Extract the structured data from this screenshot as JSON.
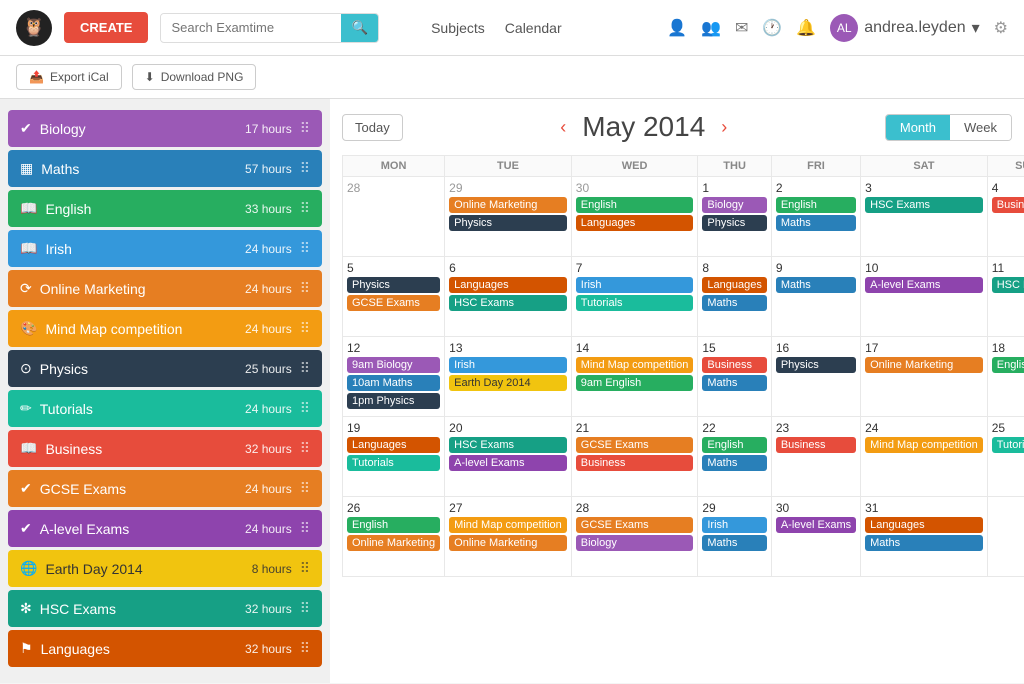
{
  "header": {
    "create_label": "CREATE",
    "search_placeholder": "Search Examtime",
    "nav": [
      "Subjects",
      "Calendar"
    ],
    "username": "andrea.leyden",
    "icons": [
      "person",
      "group",
      "mail",
      "history",
      "bell"
    ]
  },
  "toolbar": {
    "export_label": "Export iCal",
    "download_label": "Download PNG"
  },
  "sidebar": {
    "items": [
      {
        "id": "biology",
        "label": "Biology",
        "hours": "17 hours",
        "color": "#9b59b6",
        "icon": "✔",
        "css": "c-biology"
      },
      {
        "id": "maths",
        "label": "Maths",
        "hours": "57 hours",
        "color": "#2980b9",
        "icon": "▦",
        "css": "c-maths"
      },
      {
        "id": "english",
        "label": "English",
        "hours": "33 hours",
        "color": "#27ae60",
        "icon": "📖",
        "css": "c-english"
      },
      {
        "id": "irish",
        "label": "Irish",
        "hours": "24 hours",
        "color": "#3498db",
        "icon": "📖",
        "css": "c-irish"
      },
      {
        "id": "online-marketing",
        "label": "Online Marketing",
        "hours": "24 hours",
        "color": "#e67e22",
        "icon": "⟳",
        "css": "c-online-marketing"
      },
      {
        "id": "mind-map",
        "label": "Mind Map competition",
        "hours": "24 hours",
        "color": "#f39c12",
        "icon": "🎨",
        "css": "c-mind-map"
      },
      {
        "id": "physics",
        "label": "Physics",
        "hours": "25 hours",
        "color": "#2c3e50",
        "icon": "⊙",
        "css": "c-physics"
      },
      {
        "id": "tutorials",
        "label": "Tutorials",
        "hours": "24 hours",
        "color": "#1abc9c",
        "icon": "✏",
        "css": "c-tutorials"
      },
      {
        "id": "business",
        "label": "Business",
        "hours": "32 hours",
        "color": "#e74c3c",
        "icon": "📖",
        "css": "c-business"
      },
      {
        "id": "gcse",
        "label": "GCSE Exams",
        "hours": "24 hours",
        "color": "#e67e22",
        "icon": "✔",
        "css": "c-gcse"
      },
      {
        "id": "alevel",
        "label": "A-level Exams",
        "hours": "24 hours",
        "color": "#8e44ad",
        "icon": "✔",
        "css": "c-alevel"
      },
      {
        "id": "earth",
        "label": "Earth Day 2014",
        "hours": "8 hours",
        "color": "#f1c40f",
        "icon": "🌐",
        "css": "c-earth"
      },
      {
        "id": "hsc",
        "label": "HSC Exams",
        "hours": "32 hours",
        "color": "#16a085",
        "icon": "✻",
        "css": "c-hsc"
      },
      {
        "id": "languages",
        "label": "Languages",
        "hours": "32 hours",
        "color": "#d35400",
        "icon": "⚑",
        "css": "c-languages"
      }
    ]
  },
  "calendar": {
    "month_label": "May 2014",
    "today_label": "Today",
    "view_month": "Month",
    "view_week": "Week",
    "days": [
      "MON",
      "TUE",
      "WED",
      "THU",
      "FRI",
      "SAT",
      "SUN"
    ],
    "weeks": [
      {
        "dates": [
          "28",
          "29",
          "30",
          "1",
          "2",
          "3",
          "4"
        ],
        "events": [
          [],
          [
            {
              "label": "Online Marketing",
              "css": "c-online-marketing"
            },
            {
              "label": "Physics",
              "css": "c-physics"
            }
          ],
          [
            {
              "label": "English",
              "css": "c-english"
            },
            {
              "label": "Languages",
              "css": "c-languages"
            }
          ],
          [
            {
              "label": "Biology",
              "css": "c-biology"
            },
            {
              "label": "Physics",
              "css": "c-physics"
            }
          ],
          [
            {
              "label": "English",
              "css": "c-english"
            },
            {
              "label": "Maths",
              "css": "c-maths"
            }
          ],
          [
            {
              "label": "HSC Exams",
              "css": "c-hsc"
            }
          ],
          [
            {
              "label": "Business",
              "css": "c-business"
            }
          ]
        ]
      },
      {
        "dates": [
          "5",
          "6",
          "7",
          "8",
          "9",
          "10",
          "11"
        ],
        "events": [
          [
            {
              "label": "Physics",
              "css": "c-physics"
            },
            {
              "label": "GCSE Exams",
              "css": "c-gcse"
            }
          ],
          [
            {
              "label": "Languages",
              "css": "c-languages"
            },
            {
              "label": "HSC Exams",
              "css": "c-hsc"
            }
          ],
          [
            {
              "label": "Irish",
              "css": "c-irish"
            },
            {
              "label": "Tutorials",
              "css": "c-tutorials"
            }
          ],
          [
            {
              "label": "Languages",
              "css": "c-languages"
            },
            {
              "label": "Maths",
              "css": "c-maths"
            }
          ],
          [
            {
              "label": "Maths",
              "css": "c-maths"
            }
          ],
          [
            {
              "label": "A-level Exams",
              "css": "c-alevel"
            }
          ],
          [
            {
              "label": "HSC Exams",
              "css": "c-hsc"
            }
          ]
        ]
      },
      {
        "dates": [
          "12",
          "13",
          "14",
          "15",
          "16",
          "17",
          "18"
        ],
        "events": [
          [
            {
              "label": "9am Biology",
              "css": "c-biology"
            },
            {
              "label": "10am Maths",
              "css": "c-maths"
            },
            {
              "label": "1pm Physics",
              "css": "c-physics"
            }
          ],
          [
            {
              "label": "Irish",
              "css": "c-irish"
            },
            {
              "label": "Earth Day 2014",
              "css": "c-earth"
            }
          ],
          [
            {
              "label": "Mind Map competition",
              "css": "c-mind-map"
            },
            {
              "label": "9am English",
              "css": "c-english"
            }
          ],
          [
            {
              "label": "Business",
              "css": "c-business"
            },
            {
              "label": "Maths",
              "css": "c-maths"
            }
          ],
          [
            {
              "label": "Physics",
              "css": "c-physics"
            }
          ],
          [
            {
              "label": "Online Marketing",
              "css": "c-online-marketing"
            }
          ],
          [
            {
              "label": "English",
              "css": "c-english"
            }
          ]
        ]
      },
      {
        "dates": [
          "19",
          "20",
          "21",
          "22",
          "23",
          "24",
          "25"
        ],
        "events": [
          [
            {
              "label": "Languages",
              "css": "c-languages"
            },
            {
              "label": "Tutorials",
              "css": "c-tutorials"
            }
          ],
          [
            {
              "label": "HSC Exams",
              "css": "c-hsc"
            },
            {
              "label": "A-level Exams",
              "css": "c-alevel"
            }
          ],
          [
            {
              "label": "GCSE Exams",
              "css": "c-gcse"
            },
            {
              "label": "Business",
              "css": "c-business"
            }
          ],
          [
            {
              "label": "English",
              "css": "c-english"
            },
            {
              "label": "Maths",
              "css": "c-maths"
            }
          ],
          [
            {
              "label": "Business",
              "css": "c-business"
            }
          ],
          [
            {
              "label": "Mind Map competition",
              "css": "c-mind-map"
            }
          ],
          [
            {
              "label": "Tutorials",
              "css": "c-tutorials"
            }
          ]
        ]
      },
      {
        "dates": [
          "26",
          "27",
          "28",
          "29",
          "30",
          "31",
          ""
        ],
        "events": [
          [
            {
              "label": "English",
              "css": "c-english"
            },
            {
              "label": "Online Marketing",
              "css": "c-online-marketing"
            }
          ],
          [
            {
              "label": "Mind Map competition",
              "css": "c-mind-map"
            },
            {
              "label": "Online Marketing",
              "css": "c-online-marketing"
            }
          ],
          [
            {
              "label": "GCSE Exams",
              "css": "c-gcse"
            },
            {
              "label": "Biology",
              "css": "c-biology"
            }
          ],
          [
            {
              "label": "Irish",
              "css": "c-irish"
            },
            {
              "label": "Maths",
              "css": "c-maths"
            }
          ],
          [
            {
              "label": "A-level Exams",
              "css": "c-alevel"
            }
          ],
          [
            {
              "label": "Languages",
              "css": "c-languages"
            },
            {
              "label": "Maths",
              "css": "c-maths"
            }
          ],
          []
        ]
      }
    ]
  }
}
